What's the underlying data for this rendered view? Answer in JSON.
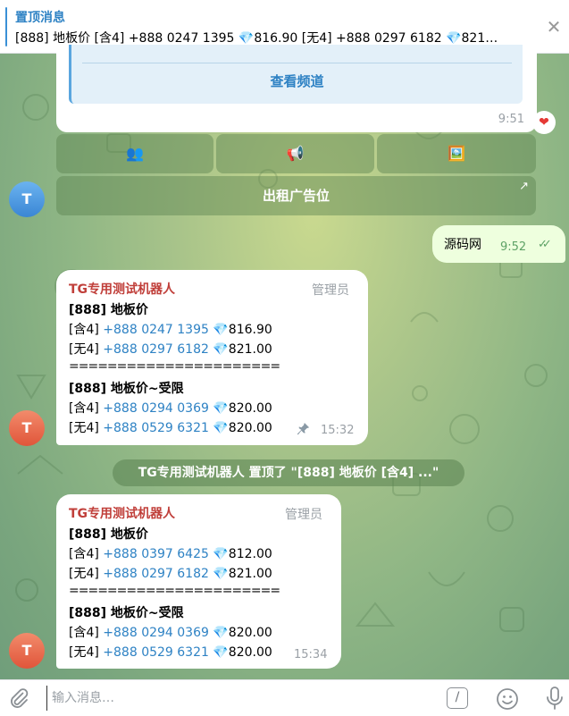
{
  "pinned": {
    "title": "置顶消息",
    "preview": "[888] 地板价 [含4]  +888 0247 1395 💎816.90 [无4]  +888 0297 6182 💎821…",
    "close": "✕"
  },
  "top_message": {
    "button": "查看频道",
    "time": "9:51",
    "reaction": "❤"
  },
  "keyboard": {
    "b1": "👥",
    "b2": "📢",
    "b3": "🖼️",
    "b4": "出租广告位",
    "b4_arrow": "↗"
  },
  "avatars": {
    "letter": "T"
  },
  "outgoing": {
    "text": "源码网",
    "time": "9:52",
    "ticks": "✓✓"
  },
  "msg1": {
    "sender": "TG专用测试机器人",
    "role": "管理员",
    "head1": "[888] 地板价",
    "r1_tag": "[含4]",
    "r1_phone": "+888 0247 1395",
    "r1_price": "💎816.90",
    "r2_tag": "[无4]",
    "r2_phone": "+888 0297 6182",
    "r2_price": "💎821.00",
    "sep": "======================",
    "head2": "[888] 地板价~受限",
    "r3_tag": "[含4]",
    "r3_phone": "+888 0294 0369",
    "r3_price": "💎820.00",
    "r4_tag": "[无4]",
    "r4_phone": "+888 0529 6321",
    "r4_price": "💎820.00",
    "time": "15:32"
  },
  "service": "TG专用测试机器人 置顶了 \"[888] 地板价 [含4]  ...\"",
  "msg2": {
    "sender": "TG专用测试机器人",
    "role": "管理员",
    "head1": "[888] 地板价",
    "r1_tag": "[含4]",
    "r1_phone": "+888 0397 6425",
    "r1_price": "💎812.00",
    "r2_tag": "[无4]",
    "r2_phone": "+888 0297 6182",
    "r2_price": "💎821.00",
    "sep": "======================",
    "head2": "[888] 地板价~受限",
    "r3_tag": "[含4]",
    "r3_phone": "+888 0294 0369",
    "r3_price": "💎820.00",
    "r4_tag": "[无4]",
    "r4_phone": "+888 0529 6321",
    "r4_price": "💎820.00",
    "time": "15:34"
  },
  "composer": {
    "placeholder": "输入消息…",
    "cmd": "/"
  },
  "colors": {
    "accent": "#2e82c4",
    "sender": "#c03f3a",
    "outgoing_bg": "#eeffde"
  }
}
